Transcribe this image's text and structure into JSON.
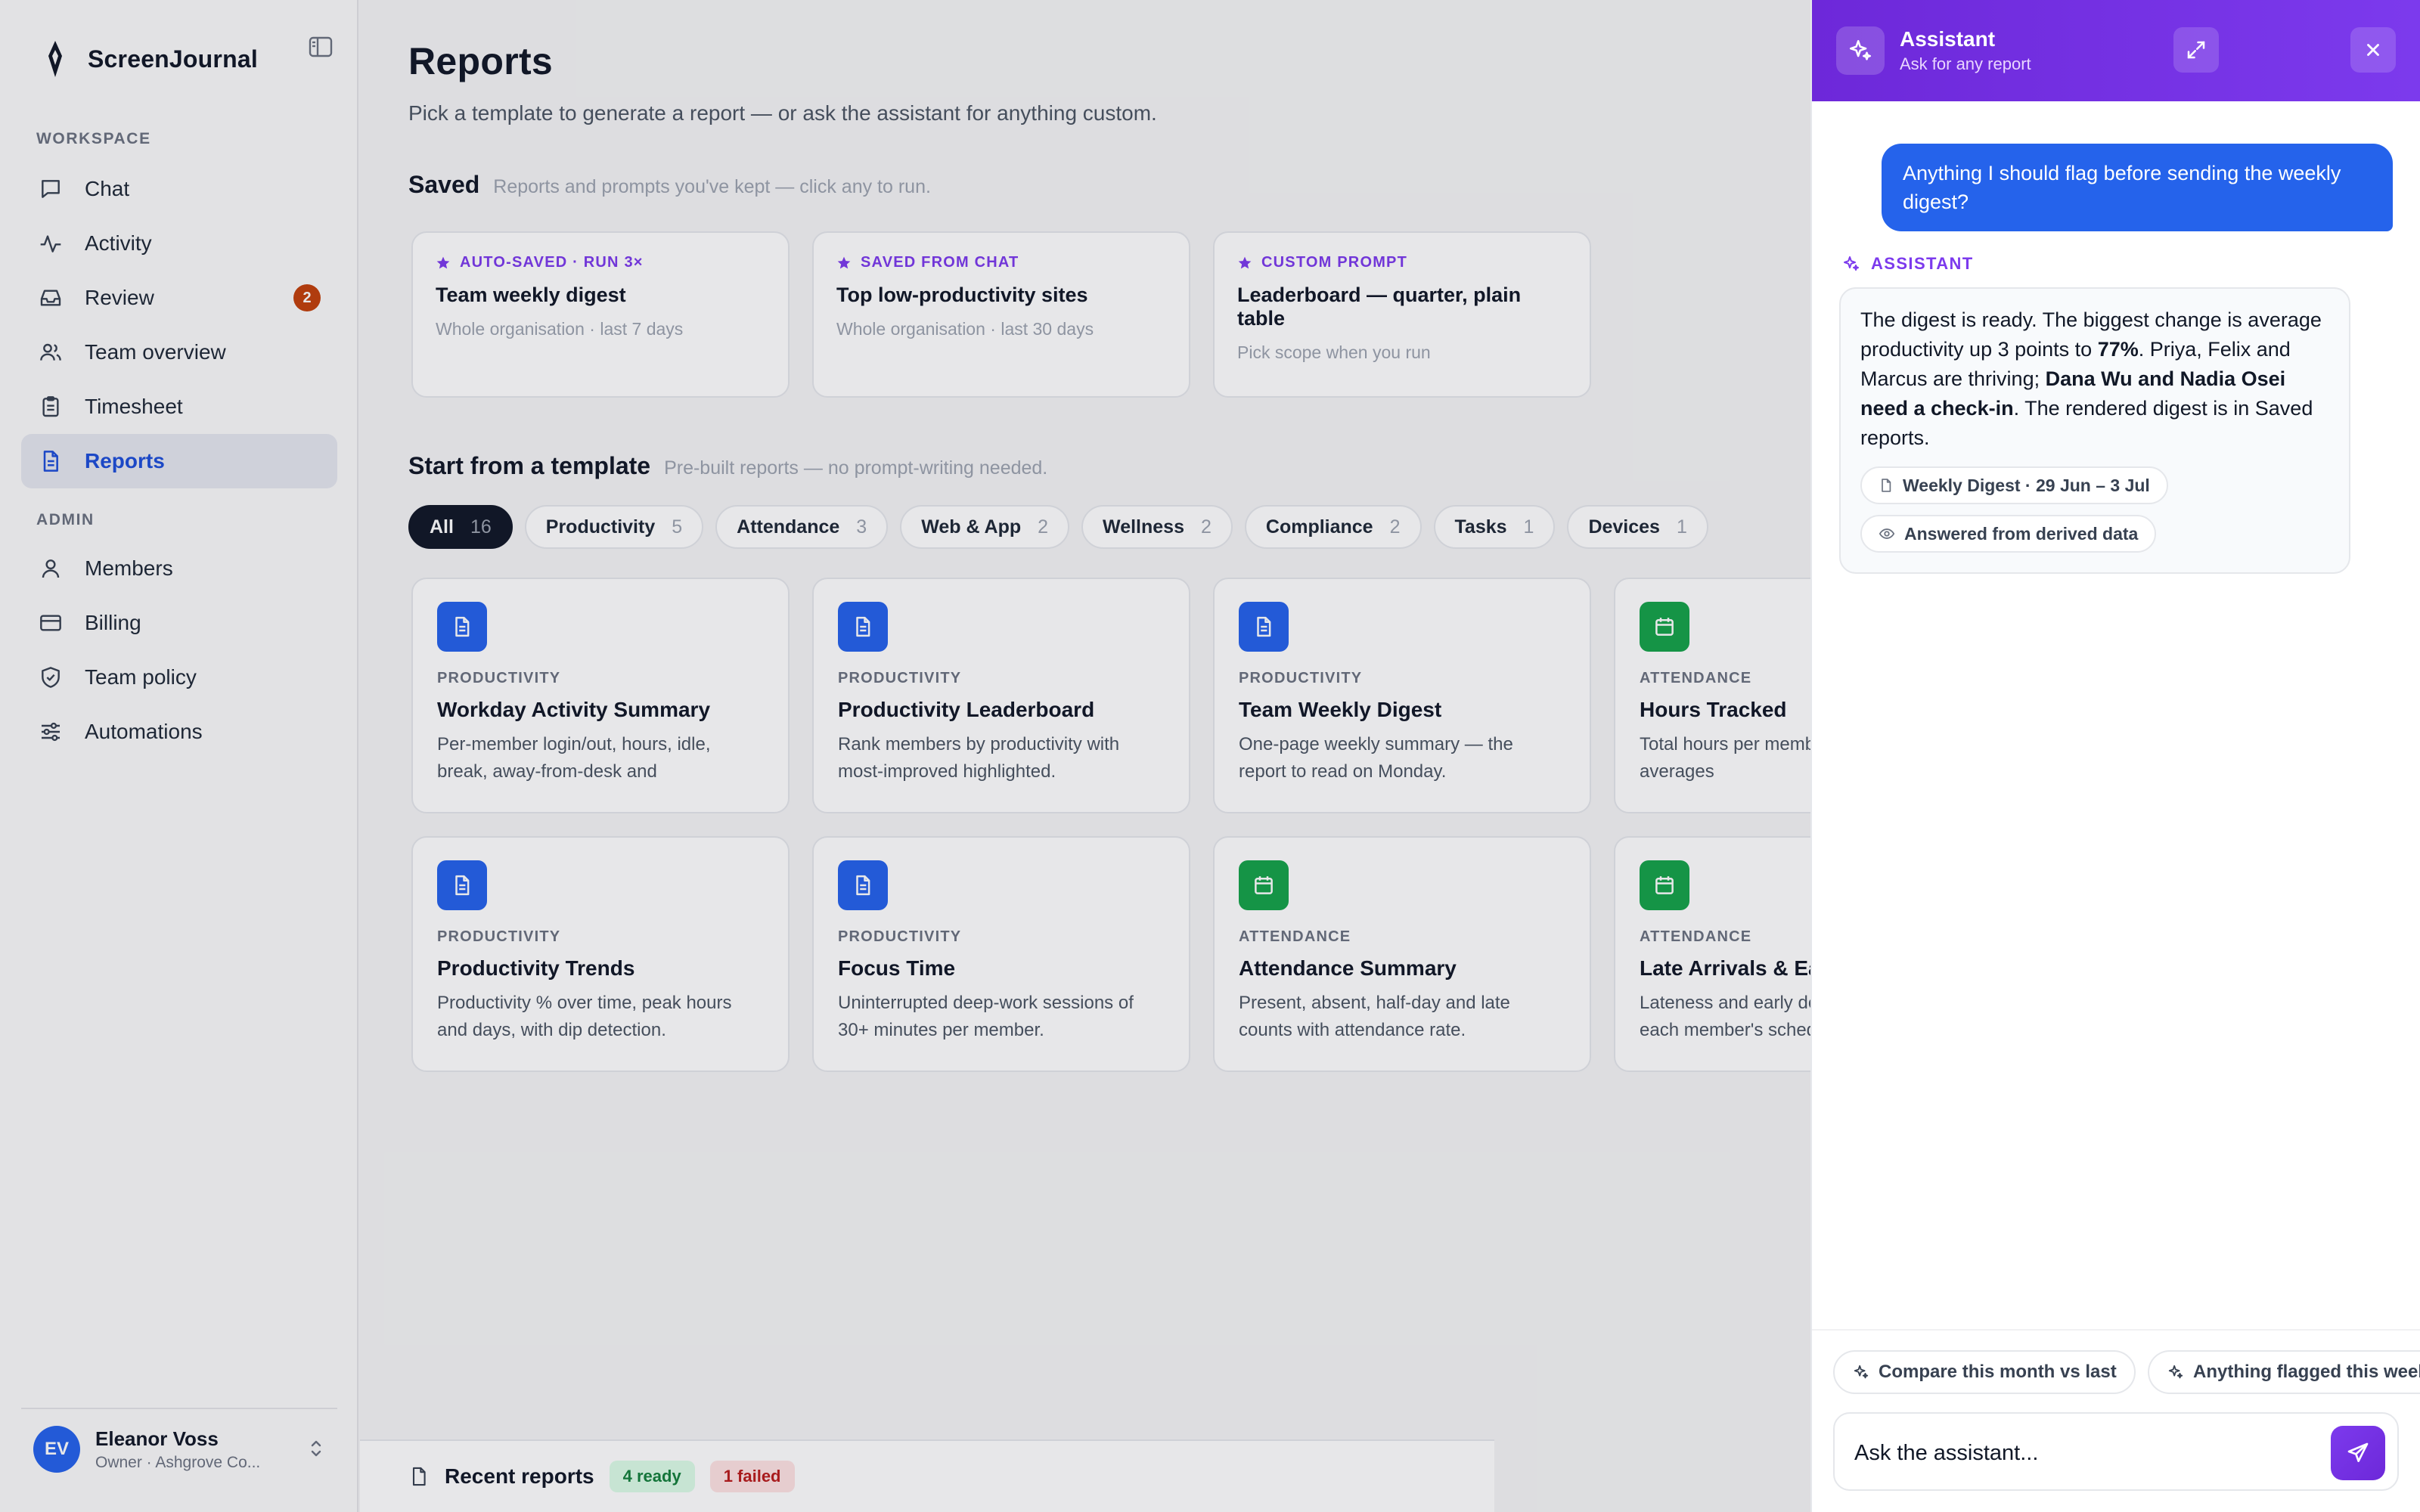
{
  "app": {
    "name": "ScreenJournal"
  },
  "sidebar": {
    "workspace_label": "WORKSPACE",
    "admin_label": "ADMIN",
    "workspace_items": [
      {
        "label": "Chat",
        "icon": "chat-icon"
      },
      {
        "label": "Activity",
        "icon": "activity-icon"
      },
      {
        "label": "Review",
        "icon": "inbox-icon",
        "badge": "2"
      },
      {
        "label": "Team overview",
        "icon": "users-icon"
      },
      {
        "label": "Timesheet",
        "icon": "clipboard-icon"
      },
      {
        "label": "Reports",
        "icon": "document-icon",
        "active": true
      }
    ],
    "admin_items": [
      {
        "label": "Members",
        "icon": "user-icon"
      },
      {
        "label": "Billing",
        "icon": "credit-card-icon"
      },
      {
        "label": "Team policy",
        "icon": "shield-icon"
      },
      {
        "label": "Automations",
        "icon": "sliders-icon"
      }
    ],
    "user": {
      "initials": "EV",
      "name": "Eleanor Voss",
      "role": "Owner · Ashgrove Co..."
    }
  },
  "main": {
    "title": "Reports",
    "subtitle": "Pick a template to generate a report — or ask the assistant for anything custom.",
    "saved": {
      "title": "Saved",
      "hint": "Reports and prompts you've kept — click any to run.",
      "cards": [
        {
          "tag": "AUTO-SAVED · RUN 3×",
          "title": "Team weekly digest",
          "meta": "Whole organisation · last 7 days"
        },
        {
          "tag": "SAVED FROM CHAT",
          "title": "Top low-productivity sites",
          "meta": "Whole organisation · last 30 days"
        },
        {
          "tag": "CUSTOM PROMPT",
          "title": "Leaderboard — quarter, plain table",
          "meta": "Pick scope when you run"
        }
      ]
    },
    "templates": {
      "title": "Start from a template",
      "hint": "Pre-built reports — no prompt-writing needed.",
      "filters": [
        {
          "label": "All",
          "count": "16",
          "active": true
        },
        {
          "label": "Productivity",
          "count": "5"
        },
        {
          "label": "Attendance",
          "count": "3"
        },
        {
          "label": "Web & App",
          "count": "2"
        },
        {
          "label": "Wellness",
          "count": "2"
        },
        {
          "label": "Compliance",
          "count": "2"
        },
        {
          "label": "Tasks",
          "count": "1"
        },
        {
          "label": "Devices",
          "count": "1"
        }
      ],
      "cards": [
        {
          "category": "PRODUCTIVITY",
          "title": "Workday Activity Summary",
          "desc": "Per-member login/out, hours, idle, break, away-from-desk and",
          "color": "#2563eb",
          "icon": "document-icon"
        },
        {
          "category": "PRODUCTIVITY",
          "title": "Productivity Leaderboard",
          "desc": "Rank members by productivity with most-improved highlighted.",
          "color": "#2563eb",
          "icon": "document-icon"
        },
        {
          "category": "PRODUCTIVITY",
          "title": "Team Weekly Digest",
          "desc": "One-page weekly summary — the report to read on Monday.",
          "color": "#2563eb",
          "icon": "document-icon"
        },
        {
          "category": "ATTENDANCE",
          "title": "Hours Tracked",
          "desc": "Total hours per member per week, with averages",
          "color": "#16a34a",
          "icon": "calendar-icon"
        },
        {
          "category": "PRODUCTIVITY",
          "title": "Productivity Trends",
          "desc": "Productivity % over time, peak hours and days, with dip detection.",
          "color": "#2563eb",
          "icon": "document-icon"
        },
        {
          "category": "PRODUCTIVITY",
          "title": "Focus Time",
          "desc": "Uninterrupted deep-work sessions of 30+ minutes per member.",
          "color": "#2563eb",
          "icon": "document-icon"
        },
        {
          "category": "ATTENDANCE",
          "title": "Attendance Summary",
          "desc": "Present, absent, half-day and late counts with attendance rate.",
          "color": "#16a34a",
          "icon": "calendar-icon"
        },
        {
          "category": "ATTENDANCE",
          "title": "Late Arrivals & Early Departures",
          "desc": "Lateness and early departures against each member's schedule.",
          "color": "#16a34a",
          "icon": "calendar-icon"
        }
      ]
    },
    "recent": {
      "label": "Recent reports",
      "ready": "4 ready",
      "failed": "1 failed"
    }
  },
  "assistant": {
    "title": "Assistant",
    "subtitle": "Ask for any report",
    "user_message": "Anything I should flag before sending the weekly digest?",
    "label": "ASSISTANT",
    "reply": {
      "p1": "The digest is ready. The biggest change is average productivity up 3 points to ",
      "b1": "77%",
      "p2": ". Priya, Felix and Marcus are thriving; ",
      "b2": "Dana Wu and Nadia Osei need a check-in",
      "p3": ". The rendered digest is in Saved reports."
    },
    "sources": [
      "Weekly Digest · 29 Jun – 3 Jul",
      "Answered from derived data"
    ],
    "suggestions": [
      "Compare this month vs last",
      "Anything flagged this week"
    ],
    "composer_placeholder": "Ask the assistant..."
  },
  "colors": {
    "accent": "#7c3aed",
    "primary": "#2563eb",
    "active_nav_bg": "#e5e7ef",
    "badge": "#c2410c"
  }
}
